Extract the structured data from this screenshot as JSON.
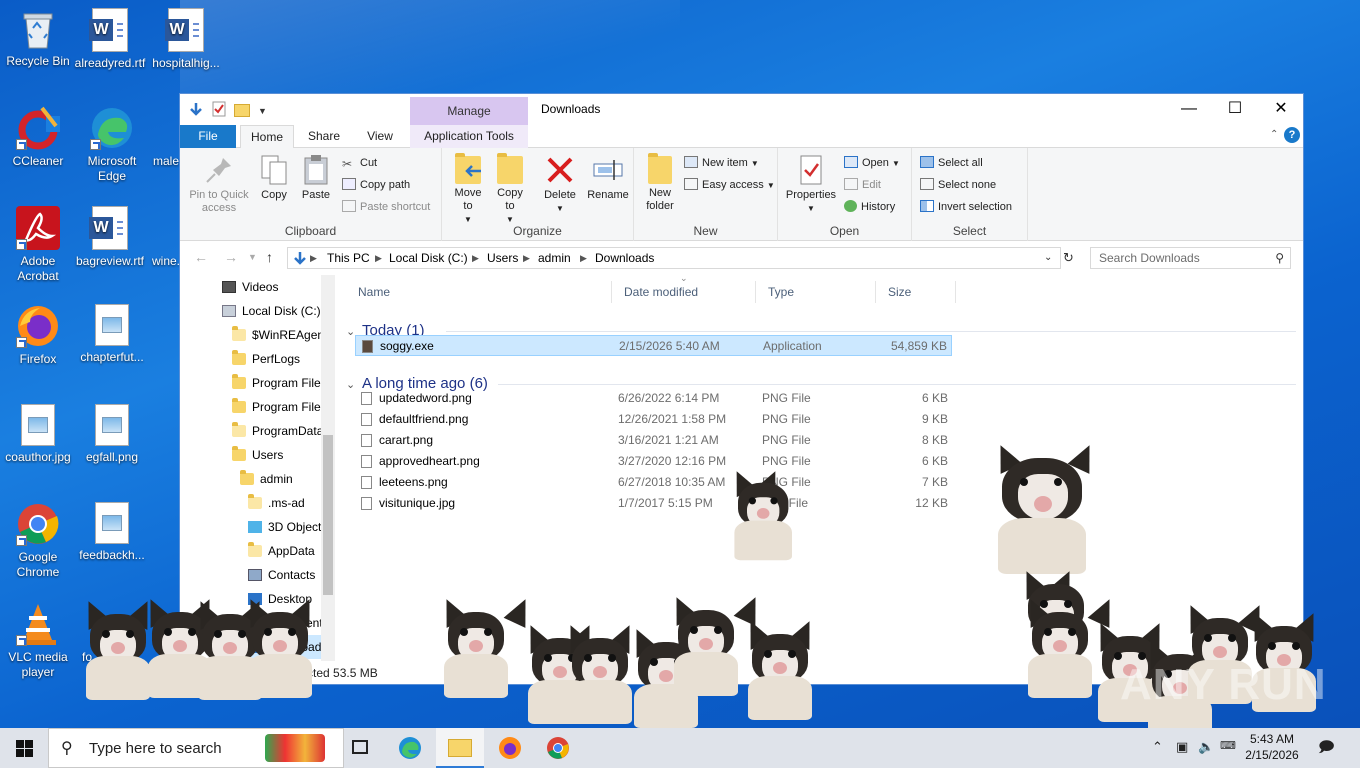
{
  "desktop": {
    "icons": [
      {
        "label": "Recycle Bin"
      },
      {
        "label": "alreadyred.rtf"
      },
      {
        "label": "hospitalhig..."
      },
      {
        "label": "CCleaner"
      },
      {
        "label": "Microsoft Edge"
      },
      {
        "label": "male..."
      },
      {
        "label": "Adobe Acrobat"
      },
      {
        "label": "bagreview.rtf"
      },
      {
        "label": "wine..."
      },
      {
        "label": "Firefox"
      },
      {
        "label": "chapterfut..."
      },
      {
        "label": "coauthor.jpg"
      },
      {
        "label": "egfall.png"
      },
      {
        "label": "Google Chrome"
      },
      {
        "label": "feedbackh..."
      },
      {
        "label": "VLC media player"
      },
      {
        "label": "fo..."
      }
    ]
  },
  "window": {
    "title": "Downloads",
    "manage_label": "Manage",
    "tabs": [
      "File",
      "Home",
      "Share",
      "View",
      "Application Tools"
    ],
    "ribbon": {
      "clipboard": {
        "label": "Clipboard",
        "pin": "Pin to Quick access",
        "copy": "Copy",
        "paste": "Paste",
        "cut": "Cut",
        "copy_path": "Copy path",
        "paste_shortcut": "Paste shortcut"
      },
      "organize": {
        "label": "Organize",
        "move_to": "Move to",
        "copy_to": "Copy to",
        "delete": "Delete",
        "rename": "Rename"
      },
      "new": {
        "label": "New",
        "new_folder": "New folder",
        "new_item": "New item",
        "easy_access": "Easy access"
      },
      "open": {
        "label": "Open",
        "properties": "Properties",
        "open": "Open",
        "edit": "Edit",
        "history": "History"
      },
      "select": {
        "label": "Select",
        "select_all": "Select all",
        "select_none": "Select none",
        "invert": "Invert selection"
      }
    },
    "address": {
      "crumbs": [
        "This PC",
        "Local Disk (C:)",
        "Users",
        "admin",
        "Downloads"
      ],
      "search_placeholder": "Search Downloads"
    },
    "navpane": [
      {
        "label": "Videos"
      },
      {
        "label": "Local Disk (C:)"
      },
      {
        "label": "$WinREAgent"
      },
      {
        "label": "PerfLogs"
      },
      {
        "label": "Program Files"
      },
      {
        "label": "Program Files"
      },
      {
        "label": "ProgramData"
      },
      {
        "label": "Users"
      },
      {
        "label": "admin"
      },
      {
        "label": ".ms-ad"
      },
      {
        "label": "3D Objects"
      },
      {
        "label": "AppData"
      },
      {
        "label": "Contacts"
      },
      {
        "label": "Desktop"
      },
      {
        "label": "Documents"
      },
      {
        "label": "Downloads"
      }
    ],
    "columns": [
      "Name",
      "Date modified",
      "Type",
      "Size"
    ],
    "groups": [
      {
        "title": "Today (1)",
        "files": [
          {
            "name": "soggy.exe",
            "date": "2/15/2026 5:40 AM",
            "type": "Application",
            "size": "54,859 KB"
          }
        ]
      },
      {
        "title": "A long time ago (6)",
        "files": [
          {
            "name": "updatedword.png",
            "date": "6/26/2022 6:14 PM",
            "type": "PNG File",
            "size": "6 KB"
          },
          {
            "name": "defaultfriend.png",
            "date": "12/26/2021 1:58 PM",
            "type": "PNG File",
            "size": "9 KB"
          },
          {
            "name": "carart.png",
            "date": "3/16/2021 1:21 AM",
            "type": "PNG File",
            "size": "8 KB"
          },
          {
            "name": "approvedheart.png",
            "date": "3/27/2020 12:16 PM",
            "type": "PNG File",
            "size": "6 KB"
          },
          {
            "name": "leeteens.png",
            "date": "6/27/2018 10:35 AM",
            "type": "PNG File",
            "size": "7 KB"
          },
          {
            "name": "visitunique.jpg",
            "date": "1/7/2017 5:15 PM",
            "type": "JPG File",
            "size": "12 KB"
          }
        ]
      }
    ],
    "status": {
      "left": "ms",
      "right": "elected  53.5 MB"
    }
  },
  "taskbar": {
    "search_text": "Type here to search",
    "time": "5:43 AM",
    "date": "2/15/2026"
  },
  "watermark": "ANY RUN"
}
